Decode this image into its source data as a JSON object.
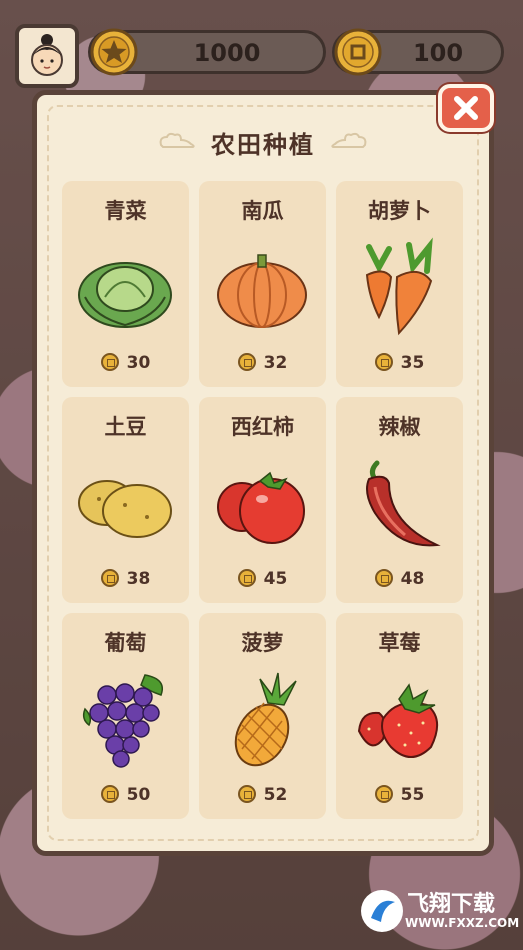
{
  "hud": {
    "gold": "1000",
    "coins": "100"
  },
  "panel": {
    "title": "农田种植"
  },
  "crops": [
    {
      "name": "青菜",
      "price": "30",
      "icon": "cabbage-icon"
    },
    {
      "name": "南瓜",
      "price": "32",
      "icon": "pumpkin-icon"
    },
    {
      "name": "胡萝卜",
      "price": "35",
      "icon": "carrot-icon"
    },
    {
      "name": "土豆",
      "price": "38",
      "icon": "potato-icon"
    },
    {
      "name": "西红柿",
      "price": "45",
      "icon": "tomato-icon"
    },
    {
      "name": "辣椒",
      "price": "48",
      "icon": "chili-icon"
    },
    {
      "name": "葡萄",
      "price": "50",
      "icon": "grape-icon"
    },
    {
      "name": "菠萝",
      "price": "52",
      "icon": "pineapple-icon"
    },
    {
      "name": "草莓",
      "price": "55",
      "icon": "strawberry-icon"
    }
  ],
  "watermark": {
    "brand": "飞翔下载",
    "url": "WWW.FXXZ.COM"
  }
}
